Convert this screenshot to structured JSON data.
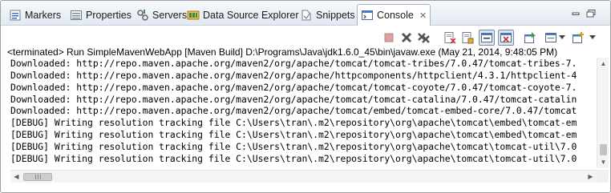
{
  "tabs": [
    {
      "label": "Markers",
      "icon": "markers-icon",
      "active": false
    },
    {
      "label": "Properties",
      "icon": "properties-icon",
      "active": false
    },
    {
      "label": "Servers",
      "icon": "servers-icon",
      "active": false
    },
    {
      "label": "Data Source Explorer",
      "icon": "data-source-explorer-icon",
      "active": false
    },
    {
      "label": "Snippets",
      "icon": "snippets-icon",
      "active": false
    },
    {
      "label": "Console",
      "icon": "console-icon",
      "active": true,
      "close_icon": "✕"
    }
  ],
  "window_controls": {
    "minimize": "minimize-icon",
    "maximize": "maximize-icon"
  },
  "toolbar": [
    {
      "name": "terminate-icon",
      "enabled": false
    },
    {
      "name": "remove-launch-icon",
      "enabled": true
    },
    {
      "name": "remove-all-terminated-icon",
      "enabled": true
    },
    {
      "name": "clear-console-icon",
      "enabled": true
    },
    {
      "name": "scroll-lock-icon",
      "enabled": true
    },
    {
      "name": "word-wrap-icon",
      "enabled": true
    },
    {
      "name": "show-on-stdout-icon",
      "enabled": true,
      "pressed": true
    },
    {
      "name": "show-on-stderr-icon",
      "enabled": true,
      "pressed": true
    },
    {
      "name": "pin-console-icon",
      "enabled": true
    },
    {
      "name": "display-selected-console-icon",
      "enabled": true
    },
    {
      "name": "open-console-icon",
      "enabled": true
    }
  ],
  "status_line": "<terminated> Run SimpleMavenWebApp [Maven Build] D:\\Programs\\Java\\jdk1.6.0_45\\bin\\javaw.exe (May 21, 2014, 9:48:05 PM)",
  "console_lines": [
    "Downloaded: http://repo.maven.apache.org/maven2/org/apache/tomcat/tomcat-tribes/7.0.47/tomcat-tribes-7.",
    "Downloaded: http://repo.maven.apache.org/maven2/org/apache/httpcomponents/httpclient/4.3.1/httpclient-4",
    "Downloaded: http://repo.maven.apache.org/maven2/org/apache/tomcat/tomcat-coyote/7.0.47/tomcat-coyote-7.",
    "Downloaded: http://repo.maven.apache.org/maven2/org/apache/tomcat/tomcat-catalina/7.0.47/tomcat-catalin",
    "Downloaded: http://repo.maven.apache.org/maven2/org/apache/tomcat/embed/tomcat-embed-core/7.0.47/tomcat",
    "[DEBUG] Writing resolution tracking file C:\\Users\\tran\\.m2\\repository\\org\\apache\\tomcat\\embed\\tomcat-em",
    "[DEBUG] Writing resolution tracking file C:\\Users\\tran\\.m2\\repository\\org\\apache\\tomcat\\embed\\tomcat-em",
    "[DEBUG] Writing resolution tracking file C:\\Users\\tran\\.m2\\repository\\org\\apache\\tomcat\\tomcat-util\\7.0",
    "[DEBUG] Writing resolution tracking file C:\\Users\\tran\\.m2\\repository\\org\\apache\\tomcat\\tomcat-util\\7.0"
  ],
  "scrollbars": {
    "vertical_position": 1.0,
    "horizontal_position": 0.0
  },
  "colors": {
    "active_tab_border": "#a8b5c7",
    "tabbar_bg": "#e3e9f1"
  }
}
